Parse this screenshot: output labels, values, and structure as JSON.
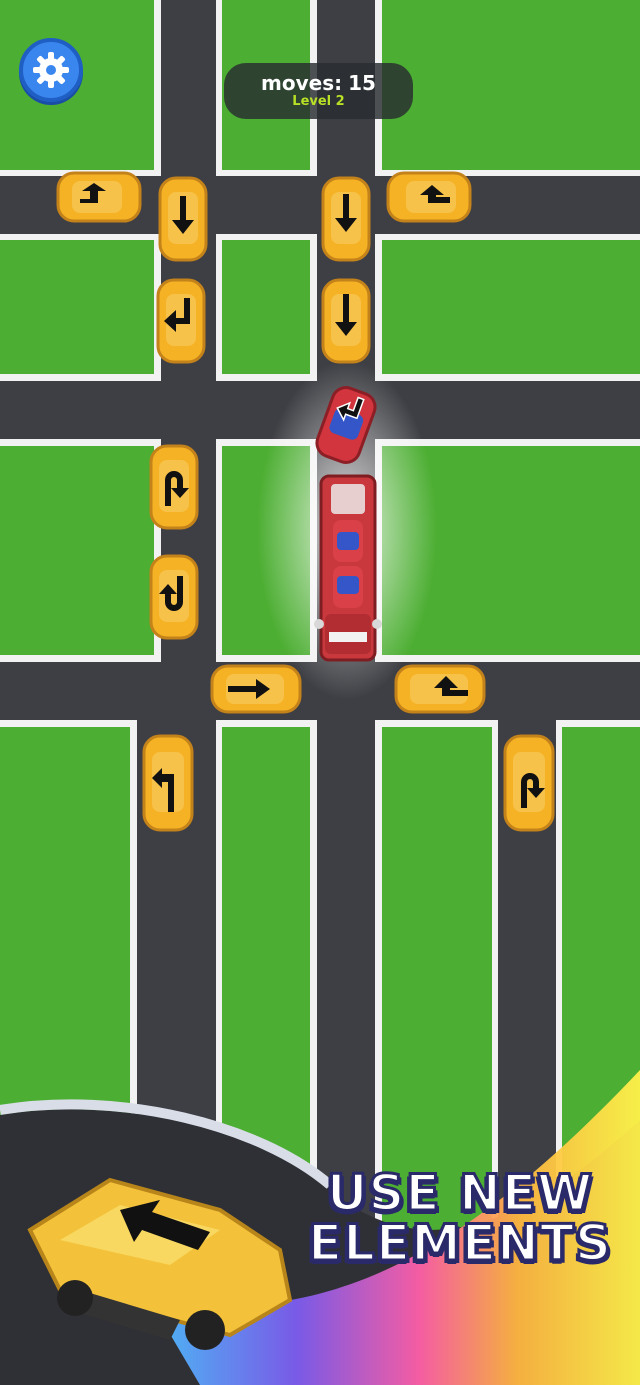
{
  "hud": {
    "moves_label": "moves:",
    "moves_value": "15",
    "level_label": "Level 2"
  },
  "settings": {
    "icon": "gear-icon"
  },
  "promo": {
    "line1": "USE NEW",
    "line2": "ELEMENTS"
  },
  "colors": {
    "grass": "#4cae32",
    "road": "#3e3f44",
    "curb": "#f4f4f4",
    "taxi": "#f5b224",
    "firetruck": "#c8383c",
    "hud_bg": "#2b2f33",
    "level_text": "#b8e026",
    "settings_button": "#3a86ef"
  },
  "vehicles": [
    {
      "type": "taxi",
      "arrow": "turn-right"
    },
    {
      "type": "taxi",
      "arrow": "down"
    },
    {
      "type": "taxi",
      "arrow": "down"
    },
    {
      "type": "taxi",
      "arrow": "turn-left"
    },
    {
      "type": "taxi",
      "arrow": "turn-left"
    },
    {
      "type": "taxi",
      "arrow": "down"
    },
    {
      "type": "red-car",
      "arrow": "turn-left"
    },
    {
      "type": "fire-truck",
      "arrow": "none"
    },
    {
      "type": "taxi",
      "arrow": "u-turn"
    },
    {
      "type": "taxi",
      "arrow": "u-turn"
    },
    {
      "type": "taxi",
      "arrow": "right"
    },
    {
      "type": "taxi",
      "arrow": "turn-left"
    },
    {
      "type": "taxi",
      "arrow": "turn-left"
    },
    {
      "type": "taxi",
      "arrow": "u-turn"
    },
    {
      "type": "promo-taxi",
      "arrow": "up-left"
    }
  ]
}
